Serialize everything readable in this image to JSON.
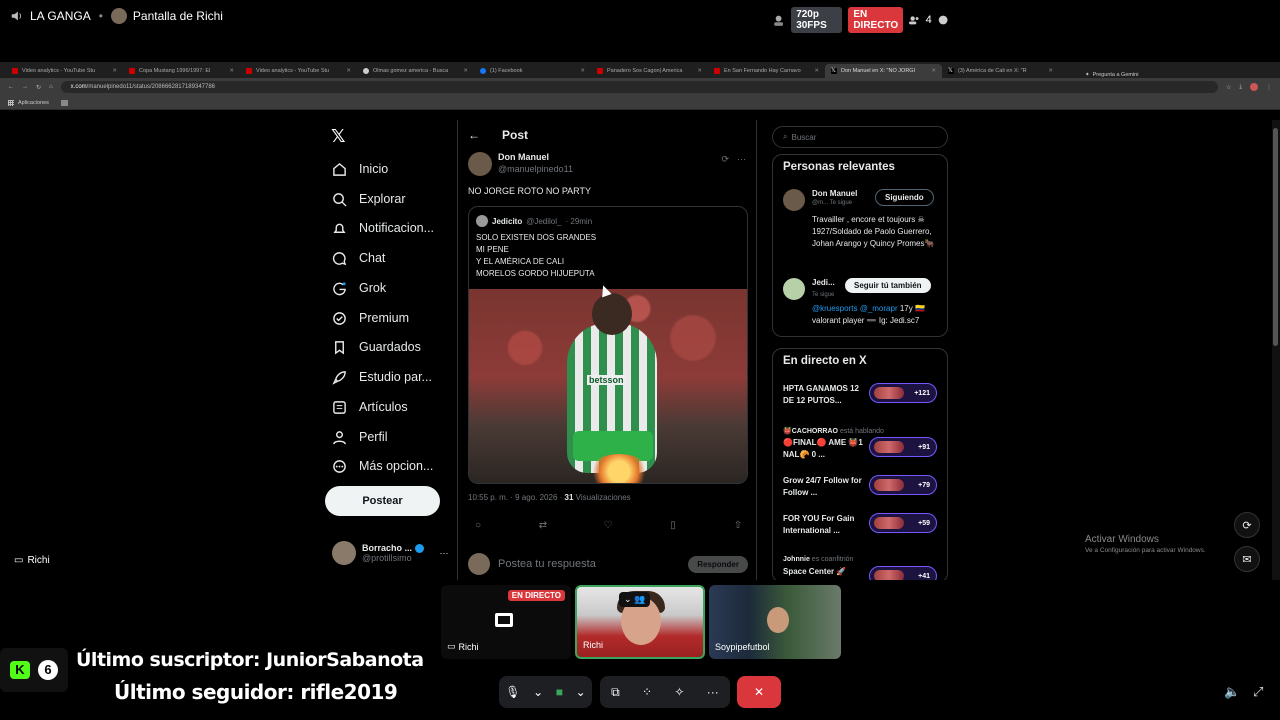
{
  "discord": {
    "server": "LA GANGA",
    "stream_title": "Pantalla de Richi",
    "quality": "720p 30FPS",
    "live": "EN DIRECTO",
    "viewers": "4"
  },
  "browser": {
    "tabs": [
      {
        "title": "Video analytics - YouTube Stu"
      },
      {
        "title": "Copa Mustang 1996/1997: El"
      },
      {
        "title": "Video analytics - YouTube Stu"
      },
      {
        "title": "Olmas gomez america - Busca"
      },
      {
        "title": "(1) Facebook"
      },
      {
        "title": "Panadero Sos Cagon| America"
      },
      {
        "title": "En San Fernando Hay Carnavo"
      },
      {
        "title": "Don Manuel en X: \"NO JORGI",
        "active": true
      },
      {
        "title": "(3) América de Cali en X: \"R"
      }
    ],
    "gemini": "Pregunta a Gemini",
    "url_host": "x.com",
    "url_path": "/manuelpinedo11/status/2086662817189347786",
    "bookmark": "Aplicaciones"
  },
  "nav": {
    "items": [
      "Inicio",
      "Explorar",
      "Notificacion...",
      "Chat",
      "Grok",
      "Premium",
      "Guardados",
      "Estudio par...",
      "Artículos",
      "Perfil",
      "Más opcion..."
    ],
    "post_button": "Postear",
    "account_name": "Borracho ...",
    "account_handle": "@protillsimo"
  },
  "post": {
    "header": "Post",
    "author_name": "Don Manuel",
    "author_handle": "@manuelpinedo11",
    "text": "NO JORGE ROTO NO PARTY",
    "quote": {
      "name": "Jedicito",
      "handle": "@Jedilol_",
      "time": "· 29min",
      "lines": [
        "SOLO EXISTEN DOS GRANDES",
        "MI PENE",
        "Y EL AMÉRICA DE CALI",
        "MORELOS GORDO HIJUEPUTA"
      ],
      "jersey_text": "betsson"
    },
    "meta_time": "10:55 p. m. · 9 ago. 2026 ·",
    "views_count": "31",
    "views_label": "Visualizaciones",
    "reply_placeholder": "Postea tu respuesta",
    "reply_button": "Responder"
  },
  "sidebar": {
    "search_placeholder": "Buscar",
    "relevant_title": "Personas relevantes",
    "people": [
      {
        "name": "Don Manuel",
        "sub": "@m... Te sigue",
        "button": "Siguiendo",
        "bio": "Travailler , encore et toujours ☠ 1927/Soldado de Paolo Guerrero, Johan Arango y Quincy Promes🐂"
      },
      {
        "name": "Jedi...",
        "sub": "Te sigue",
        "button": "Seguir tú también",
        "bio_link": "@kruesports @_morapr",
        "bio": " 17y 🇨🇴 valorant player ➖ Ig: Jedi.sc7"
      }
    ],
    "live_title": "En directo en X",
    "spaces": [
      {
        "title": "HPTA GANAMOS 12 DE 12 PUTOS...",
        "count": "+121",
        "host": ""
      },
      {
        "title": "🔴FINAL🔴 AME 👹1 NAL🥐 0 ...",
        "count": "+91",
        "host_name": "👹CACHORRAO",
        "host_state": "está hablando"
      },
      {
        "title": "Grow 24/7 Follow for Follow ...",
        "count": "+79",
        "host": ""
      },
      {
        "title": "FOR YOU For Gain International ...",
        "count": "+59",
        "host": ""
      },
      {
        "title": "Space Center 🚀",
        "count": "+41",
        "host_name": "Johnnie",
        "host_state": "es coanfitrión"
      }
    ]
  },
  "windows": {
    "line1": "Activar Windows",
    "line2": "Ve a Configuración para activar Windows."
  },
  "call": {
    "left_label": "Richi",
    "tiles": [
      {
        "label": "Richi",
        "badge": "EN DIRECTO"
      },
      {
        "label": "Richi"
      },
      {
        "label": "Soypipefutbol"
      }
    ]
  },
  "overlay": {
    "kick_count": "6",
    "last_sub": "Último suscriptor: JuniorSabanota",
    "last_follower": "Último seguidor: rifle2019"
  }
}
